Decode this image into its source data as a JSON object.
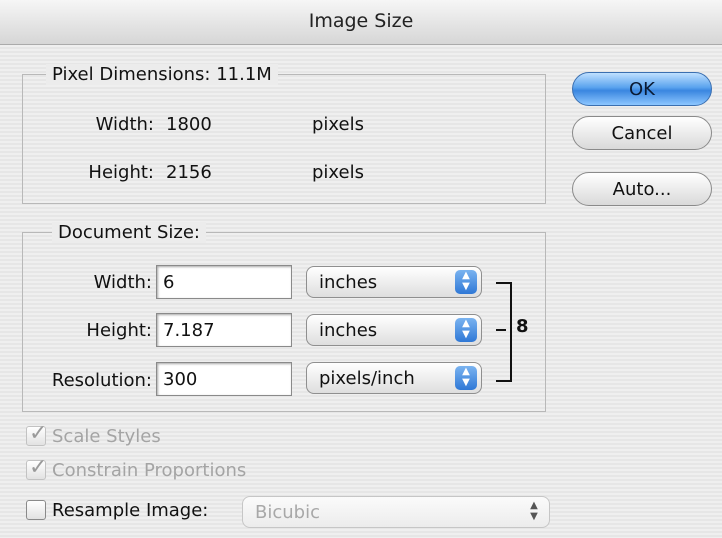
{
  "window": {
    "title": "Image Size"
  },
  "pixel_dimensions": {
    "label": "Pixel Dimensions:",
    "size": "11.1M",
    "width_label": "Width:",
    "width_value": "1800",
    "width_unit": "pixels",
    "height_label": "Height:",
    "height_value": "2156",
    "height_unit": "pixels"
  },
  "document_size": {
    "label": "Document Size:",
    "width_label": "Width:",
    "width_value": "6",
    "width_unit": "inches",
    "height_label": "Height:",
    "height_value": "7.187",
    "height_unit": "inches",
    "resolution_label": "Resolution:",
    "resolution_value": "300",
    "resolution_unit": "pixels/inch"
  },
  "buttons": {
    "ok": "OK",
    "cancel": "Cancel",
    "auto": "Auto..."
  },
  "options": {
    "scale_styles": {
      "label": "Scale Styles",
      "checked": true,
      "enabled": false
    },
    "constrain": {
      "label": "Constrain Proportions",
      "checked": true,
      "enabled": false
    },
    "resample": {
      "label": "Resample Image:",
      "checked": false,
      "enabled": true,
      "method": "Bicubic"
    }
  },
  "icons": {
    "stepper": "up-down-arrows",
    "check": "checkmark",
    "link": "chain-link"
  }
}
